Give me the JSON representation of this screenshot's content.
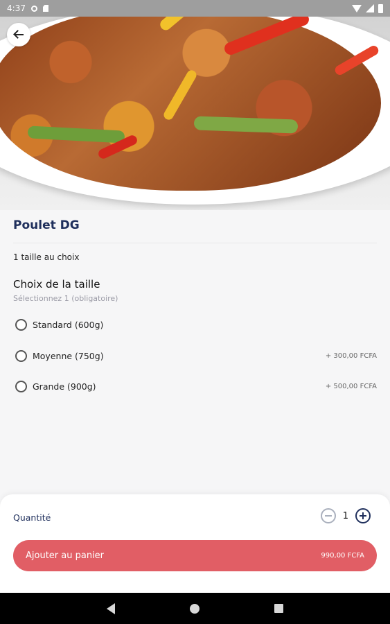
{
  "status_bar": {
    "time": "4:37"
  },
  "product": {
    "title": "Poulet DG",
    "description": "1 taille au choix"
  },
  "size_section": {
    "title": "Choix de la taille",
    "subtitle": "Sélectionnez 1 (obligatoire)",
    "options": [
      {
        "label": "Standard (600g)",
        "price": ""
      },
      {
        "label": "Moyenne (750g)",
        "price": "+ 300,00 FCFA"
      },
      {
        "label": "Grande (900g)",
        "price": "+ 500,00 FCFA"
      }
    ]
  },
  "quantity": {
    "label": "Quantité",
    "value": "1"
  },
  "add_button": {
    "label": "Ajouter au panier",
    "price": "990,00 FCFA"
  },
  "colors": {
    "brand_title": "#1f2f5c",
    "cta": "#e15e65"
  },
  "icons": [
    "settings-icon",
    "sd-card-icon",
    "wifi-icon",
    "signal-icon",
    "battery-icon",
    "back-arrow-icon",
    "minus-circle-icon",
    "plus-circle-icon",
    "nav-back-icon",
    "nav-home-icon",
    "nav-recents-icon"
  ]
}
